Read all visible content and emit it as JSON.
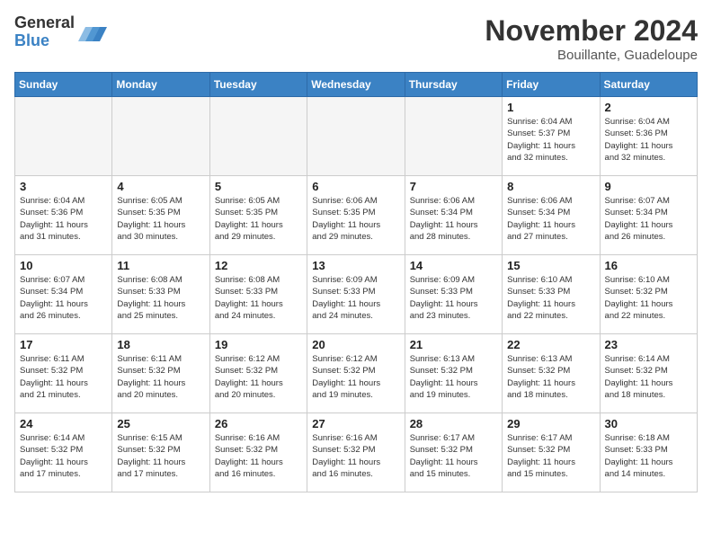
{
  "header": {
    "logo_general": "General",
    "logo_blue": "Blue",
    "month_year": "November 2024",
    "location": "Bouillante, Guadeloupe"
  },
  "days_of_week": [
    "Sunday",
    "Monday",
    "Tuesday",
    "Wednesday",
    "Thursday",
    "Friday",
    "Saturday"
  ],
  "weeks": [
    [
      {
        "num": "",
        "info": ""
      },
      {
        "num": "",
        "info": ""
      },
      {
        "num": "",
        "info": ""
      },
      {
        "num": "",
        "info": ""
      },
      {
        "num": "",
        "info": ""
      },
      {
        "num": "1",
        "info": "Sunrise: 6:04 AM\nSunset: 5:37 PM\nDaylight: 11 hours\nand 32 minutes."
      },
      {
        "num": "2",
        "info": "Sunrise: 6:04 AM\nSunset: 5:36 PM\nDaylight: 11 hours\nand 32 minutes."
      }
    ],
    [
      {
        "num": "3",
        "info": "Sunrise: 6:04 AM\nSunset: 5:36 PM\nDaylight: 11 hours\nand 31 minutes."
      },
      {
        "num": "4",
        "info": "Sunrise: 6:05 AM\nSunset: 5:35 PM\nDaylight: 11 hours\nand 30 minutes."
      },
      {
        "num": "5",
        "info": "Sunrise: 6:05 AM\nSunset: 5:35 PM\nDaylight: 11 hours\nand 29 minutes."
      },
      {
        "num": "6",
        "info": "Sunrise: 6:06 AM\nSunset: 5:35 PM\nDaylight: 11 hours\nand 29 minutes."
      },
      {
        "num": "7",
        "info": "Sunrise: 6:06 AM\nSunset: 5:34 PM\nDaylight: 11 hours\nand 28 minutes."
      },
      {
        "num": "8",
        "info": "Sunrise: 6:06 AM\nSunset: 5:34 PM\nDaylight: 11 hours\nand 27 minutes."
      },
      {
        "num": "9",
        "info": "Sunrise: 6:07 AM\nSunset: 5:34 PM\nDaylight: 11 hours\nand 26 minutes."
      }
    ],
    [
      {
        "num": "10",
        "info": "Sunrise: 6:07 AM\nSunset: 5:34 PM\nDaylight: 11 hours\nand 26 minutes."
      },
      {
        "num": "11",
        "info": "Sunrise: 6:08 AM\nSunset: 5:33 PM\nDaylight: 11 hours\nand 25 minutes."
      },
      {
        "num": "12",
        "info": "Sunrise: 6:08 AM\nSunset: 5:33 PM\nDaylight: 11 hours\nand 24 minutes."
      },
      {
        "num": "13",
        "info": "Sunrise: 6:09 AM\nSunset: 5:33 PM\nDaylight: 11 hours\nand 24 minutes."
      },
      {
        "num": "14",
        "info": "Sunrise: 6:09 AM\nSunset: 5:33 PM\nDaylight: 11 hours\nand 23 minutes."
      },
      {
        "num": "15",
        "info": "Sunrise: 6:10 AM\nSunset: 5:33 PM\nDaylight: 11 hours\nand 22 minutes."
      },
      {
        "num": "16",
        "info": "Sunrise: 6:10 AM\nSunset: 5:32 PM\nDaylight: 11 hours\nand 22 minutes."
      }
    ],
    [
      {
        "num": "17",
        "info": "Sunrise: 6:11 AM\nSunset: 5:32 PM\nDaylight: 11 hours\nand 21 minutes."
      },
      {
        "num": "18",
        "info": "Sunrise: 6:11 AM\nSunset: 5:32 PM\nDaylight: 11 hours\nand 20 minutes."
      },
      {
        "num": "19",
        "info": "Sunrise: 6:12 AM\nSunset: 5:32 PM\nDaylight: 11 hours\nand 20 minutes."
      },
      {
        "num": "20",
        "info": "Sunrise: 6:12 AM\nSunset: 5:32 PM\nDaylight: 11 hours\nand 19 minutes."
      },
      {
        "num": "21",
        "info": "Sunrise: 6:13 AM\nSunset: 5:32 PM\nDaylight: 11 hours\nand 19 minutes."
      },
      {
        "num": "22",
        "info": "Sunrise: 6:13 AM\nSunset: 5:32 PM\nDaylight: 11 hours\nand 18 minutes."
      },
      {
        "num": "23",
        "info": "Sunrise: 6:14 AM\nSunset: 5:32 PM\nDaylight: 11 hours\nand 18 minutes."
      }
    ],
    [
      {
        "num": "24",
        "info": "Sunrise: 6:14 AM\nSunset: 5:32 PM\nDaylight: 11 hours\nand 17 minutes."
      },
      {
        "num": "25",
        "info": "Sunrise: 6:15 AM\nSunset: 5:32 PM\nDaylight: 11 hours\nand 17 minutes."
      },
      {
        "num": "26",
        "info": "Sunrise: 6:16 AM\nSunset: 5:32 PM\nDaylight: 11 hours\nand 16 minutes."
      },
      {
        "num": "27",
        "info": "Sunrise: 6:16 AM\nSunset: 5:32 PM\nDaylight: 11 hours\nand 16 minutes."
      },
      {
        "num": "28",
        "info": "Sunrise: 6:17 AM\nSunset: 5:32 PM\nDaylight: 11 hours\nand 15 minutes."
      },
      {
        "num": "29",
        "info": "Sunrise: 6:17 AM\nSunset: 5:32 PM\nDaylight: 11 hours\nand 15 minutes."
      },
      {
        "num": "30",
        "info": "Sunrise: 6:18 AM\nSunset: 5:33 PM\nDaylight: 11 hours\nand 14 minutes."
      }
    ]
  ]
}
